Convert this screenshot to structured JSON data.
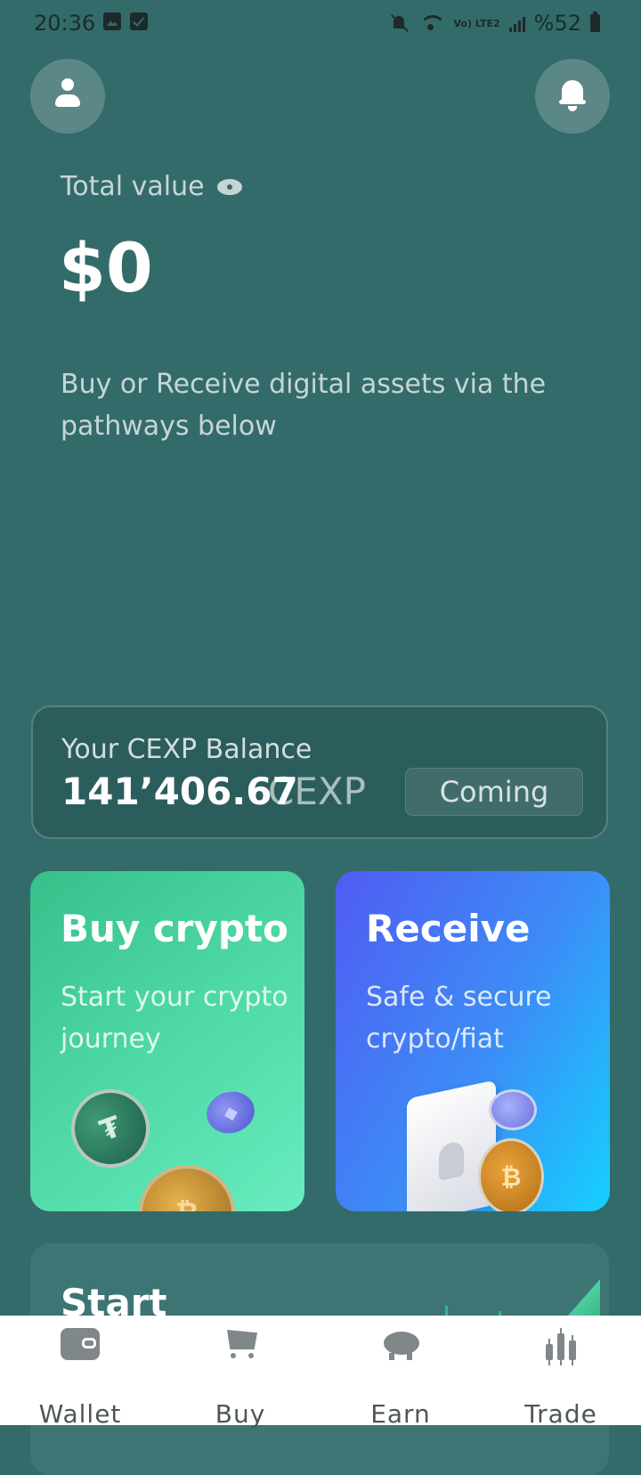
{
  "status_bar": {
    "time": "20:36",
    "network_label": "Vo) LTE2",
    "battery": "%52"
  },
  "header": {
    "profile_icon": "user-icon",
    "notifications_icon": "bell-icon"
  },
  "portfolio": {
    "total_label": "Total value",
    "visibility_icon": "eye-icon",
    "total_value": "$0",
    "hint": "Buy or Receive digital assets via the pathways below"
  },
  "cexp": {
    "label": "Your CEXP Balance",
    "amount": "141’406.67",
    "unit": "CEXP",
    "button_label": "Coming"
  },
  "cards": {
    "buy": {
      "title": "Buy crypto",
      "subtitle": "Start your crypto journey"
    },
    "receive": {
      "title": "Receive",
      "subtitle": "Safe & secure crypto/fiat"
    },
    "start": {
      "title": "Start"
    }
  },
  "bottom_nav": {
    "items": [
      {
        "label": "Wallet",
        "icon": "wallet-icon"
      },
      {
        "label": "Buy",
        "icon": "cart-icon"
      },
      {
        "label": "Earn",
        "icon": "piggy-bank-icon"
      },
      {
        "label": "Trade",
        "icon": "candlestick-icon"
      }
    ]
  },
  "colors": {
    "background": "#336b6a",
    "buy_card": "#50dba8",
    "receive_card": "#3c8df6",
    "nav_background": "#ffffff"
  }
}
